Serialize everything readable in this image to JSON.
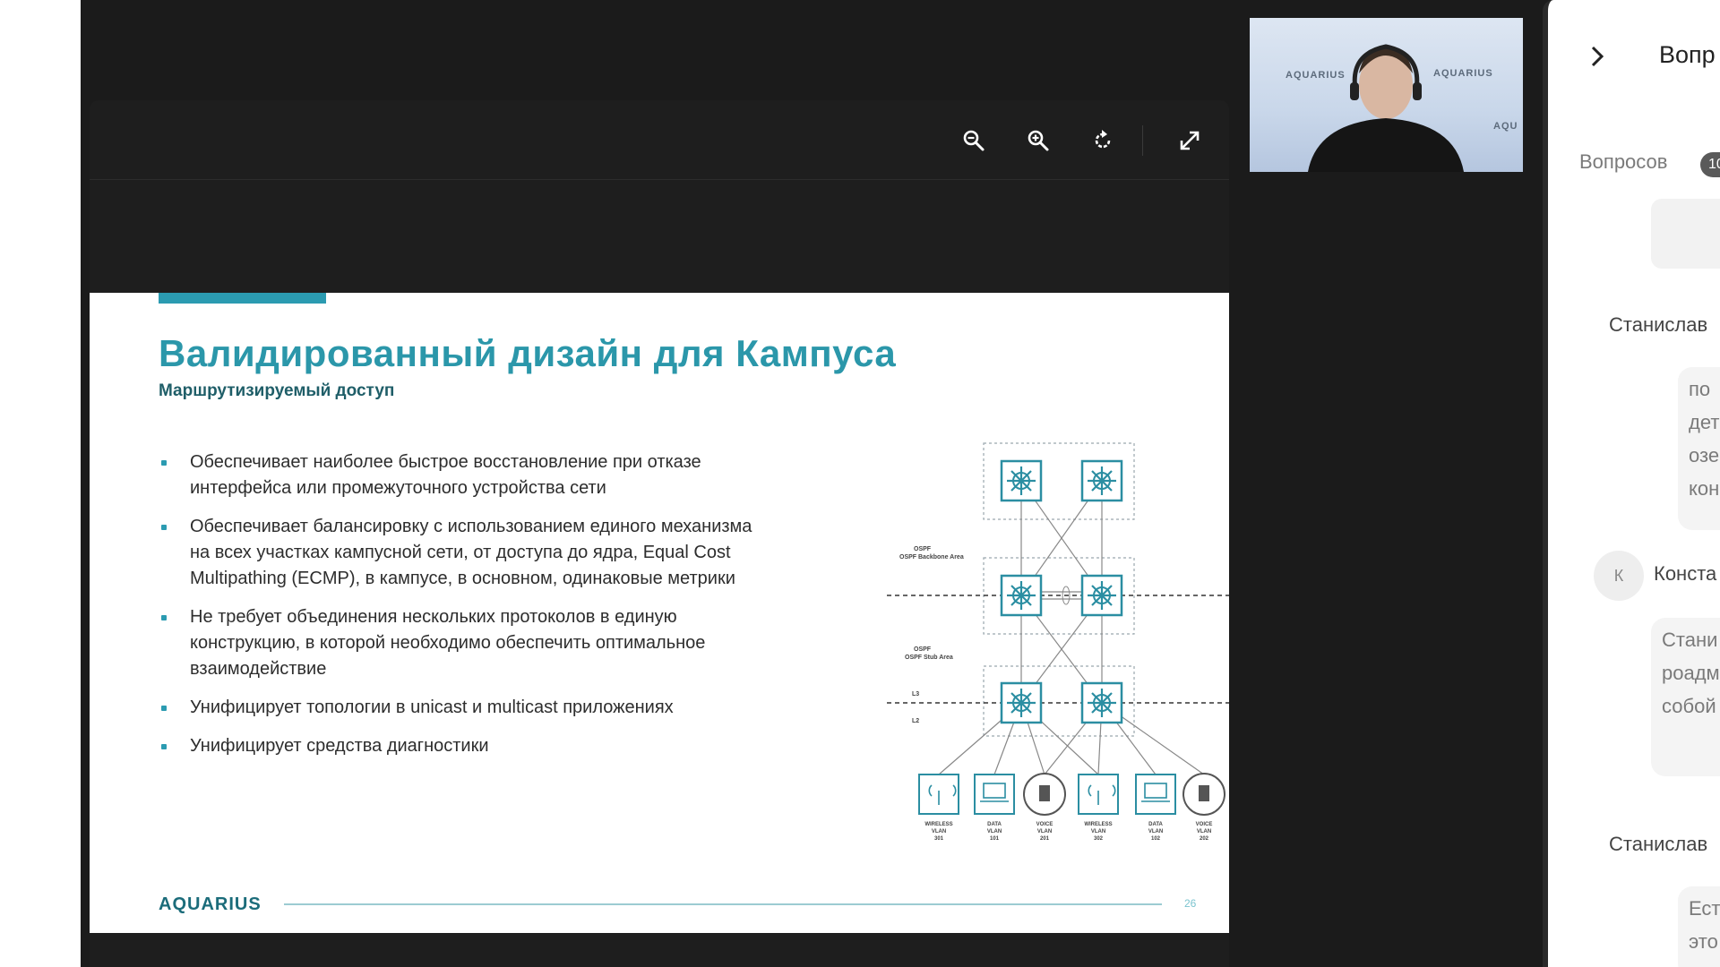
{
  "viewer": {
    "toolbar": {
      "zoom_out_icon": "zoom-out-icon",
      "zoom_in_icon": "zoom-in-icon",
      "rotate_icon": "rotate-icon",
      "fullscreen_icon": "fullscreen-icon"
    }
  },
  "slide": {
    "title": "Валидированный дизайн для Кампуса",
    "subtitle": "Маршрутизируемый доступ",
    "bullets": [
      "Обеспечивает наиболее быстрое восстановление при отказе интерфейса или промежуточного устройства сети",
      "Обеспечивает балансировку с использованием единого механизма на всех участках кампусной сети, от доступа до ядра, Equal Cost Multipathing (ECMP), в кампусе, в основном, одинаковые метрики",
      "Не требует объединения нескольких протоколов в единую конструкцию, в которой необходимо обеспечить оптимальное взаимодействие",
      "Унифицирует топологии в unicast и multicast приложениях",
      "Унифицирует средства диагностики"
    ],
    "footer_logo": "AQUARIUS",
    "page_number": "26",
    "accent_color": "#2b9bb1",
    "diagram": {
      "area_labels": [
        "OSPF Backbone Area",
        "OSPF Stub Area"
      ],
      "layer_labels": [
        "L3",
        "L2"
      ],
      "endpoint_labels": [
        [
          "WIRELESS",
          "VLAN",
          "301"
        ],
        [
          "DATA",
          "VLAN",
          "101"
        ],
        [
          "VOICE",
          "VLAN",
          "201"
        ],
        [
          "WIRELESS",
          "VLAN",
          "302"
        ],
        [
          "DATA",
          "VLAN",
          "102"
        ],
        [
          "VOICE",
          "VLAN",
          "202"
        ]
      ]
    }
  },
  "video": {
    "backdrop_labels": [
      "AQUARIUS",
      "AQUARIUS",
      "AQU"
    ]
  },
  "panel": {
    "title": "Вопр",
    "questions_label": "Вопросов",
    "questions_count": "10",
    "entries": [
      {
        "author": "Станислав",
        "text": [
          "по",
          "дет",
          "озе",
          "кон"
        ]
      },
      {
        "author": "Конста",
        "avatar_initial": "К",
        "text": [
          "Стани",
          "роадм",
          "собой"
        ]
      },
      {
        "author": "Станислав",
        "text": [
          "Ест",
          "это"
        ]
      }
    ]
  }
}
